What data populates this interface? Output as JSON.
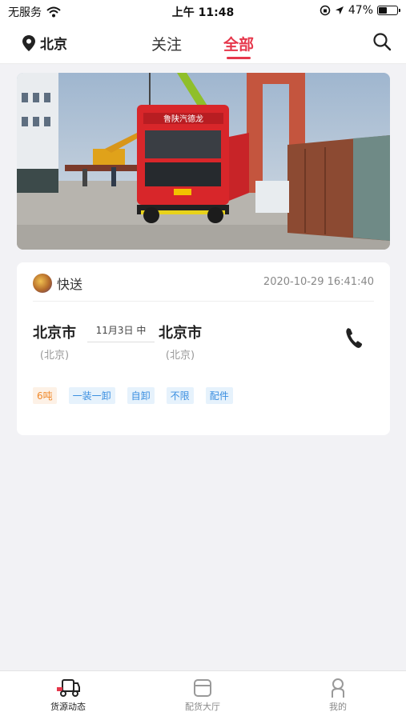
{
  "status_bar": {
    "carrier": "无服务",
    "time": "上午 11:48",
    "battery_text": "47%",
    "battery_level": 0.47
  },
  "nav": {
    "location": "北京",
    "tabs": [
      {
        "label": "关注",
        "active": false
      },
      {
        "label": "全部",
        "active": true
      }
    ],
    "icons": [
      "location-pin-icon",
      "search-icon"
    ]
  },
  "banner": {
    "truck_plate_text": "鲁陕汽德龙"
  },
  "card": {
    "sender_name": "快送",
    "datetime": "2020-10-29 16:41:40",
    "from_city": "北京市",
    "from_province": "(北京)",
    "to_city": "北京市",
    "to_province": "(北京)",
    "date_label": "11月3日  中",
    "tags": [
      "6吨",
      "一装一卸",
      "自卸",
      "不限",
      "配件"
    ],
    "colors": {
      "weight_tag": "#f08a2c",
      "tag": "#3a8ee0"
    }
  },
  "tab_bar": {
    "items": [
      {
        "label": "货源动态",
        "icon": "truck-icon",
        "active": true
      },
      {
        "label": "配货大厅",
        "icon": "box-icon",
        "active": false
      },
      {
        "label": "我的",
        "icon": "user-icon",
        "active": false
      }
    ]
  },
  "accent_color": "#e6374b"
}
